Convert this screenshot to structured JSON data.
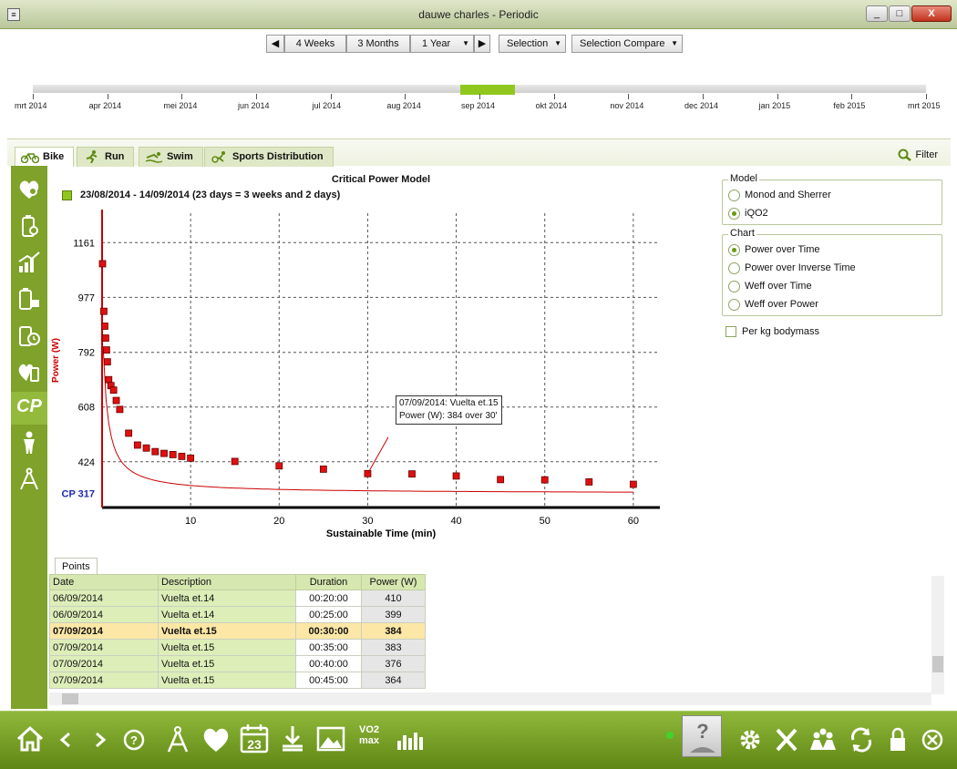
{
  "window": {
    "title": "dauwe charles - Periodic"
  },
  "nav": {
    "buttons": [
      "4 Weeks",
      "3 Months",
      "1 Year",
      "Selection",
      "Selection Compare"
    ]
  },
  "timeline": {
    "labels": [
      "mrt 2014",
      "apr 2014",
      "mei 2014",
      "jun 2014",
      "jul 2014",
      "aug 2014",
      "sep 2014",
      "okt 2014",
      "nov 2014",
      "dec 2014",
      "jan 2015",
      "feb 2015",
      "mrt 2015"
    ]
  },
  "tabs": [
    {
      "label": "Bike"
    },
    {
      "label": "Run"
    },
    {
      "label": "Swim"
    },
    {
      "label": "Sports Distribution"
    }
  ],
  "filter_label": "Filter",
  "chart_data": {
    "type": "scatter",
    "title": "Critical Power Model",
    "subtitle": "23/08/2014 - 14/09/2014 (23 days = 3 weeks and 2 days)",
    "xlabel": "Sustainable Time (min)",
    "ylabel": "Power (W)",
    "y_ticks": [
      1161,
      977,
      792,
      608,
      424
    ],
    "x_ticks": [
      10,
      20,
      30,
      40,
      50,
      60
    ],
    "cp_label": "CP 317",
    "cp": 317,
    "xlim": [
      0,
      63
    ],
    "ylim": [
      270,
      1260
    ],
    "points": [
      [
        0.05,
        1090
      ],
      [
        0.2,
        930
      ],
      [
        0.3,
        880
      ],
      [
        0.4,
        840
      ],
      [
        0.5,
        800
      ],
      [
        0.6,
        760
      ],
      [
        0.75,
        700
      ],
      [
        1,
        680
      ],
      [
        1.3,
        665
      ],
      [
        1.6,
        630
      ],
      [
        2,
        600
      ],
      [
        3,
        520
      ],
      [
        4,
        480
      ],
      [
        5,
        470
      ],
      [
        6,
        458
      ],
      [
        7,
        452
      ],
      [
        8,
        448
      ],
      [
        9,
        442
      ],
      [
        10,
        436
      ],
      [
        15,
        425
      ],
      [
        20,
        410
      ],
      [
        25,
        399
      ],
      [
        30,
        384
      ],
      [
        35,
        383
      ],
      [
        40,
        376
      ],
      [
        45,
        364
      ],
      [
        50,
        363
      ],
      [
        55,
        356
      ],
      [
        60,
        348
      ]
    ],
    "tooltip": [
      "07/09/2014: Vuelta et.15",
      "Power (W): 384 over 30'"
    ]
  },
  "model_panel": {
    "title": "Model",
    "options": [
      "Monod and Sherrer",
      "iQO2"
    ],
    "selected": 1
  },
  "chart_panel": {
    "title": "Chart",
    "options": [
      "Power over Time",
      "Power over Inverse Time",
      "Weff over Time",
      "Weff over Power"
    ],
    "selected": 0
  },
  "per_kg": "Per kg bodymass",
  "points_panel": {
    "tab": "Points",
    "columns": [
      "Date",
      "Description",
      "Duration",
      "Power (W)"
    ],
    "rows": [
      [
        "06/09/2014",
        "Vuelta et.14",
        "00:20:00",
        "410"
      ],
      [
        "06/09/2014",
        "Vuelta et.14",
        "00:25:00",
        "399"
      ],
      [
        "07/09/2014",
        "Vuelta et.15",
        "00:30:00",
        "384"
      ],
      [
        "07/09/2014",
        "Vuelta et.15",
        "00:35:00",
        "383"
      ],
      [
        "07/09/2014",
        "Vuelta et.15",
        "00:40:00",
        "376"
      ],
      [
        "07/09/2014",
        "Vuelta et.15",
        "00:45:00",
        "364"
      ]
    ],
    "selected_row": 2
  },
  "side_labels": {
    "cp": "CP"
  },
  "bottom_vo2": "VO2 max",
  "bottom_cal": "23",
  "colors": {
    "accent": "#8fc71f",
    "point": "#cc0000",
    "axis": "#000000"
  }
}
